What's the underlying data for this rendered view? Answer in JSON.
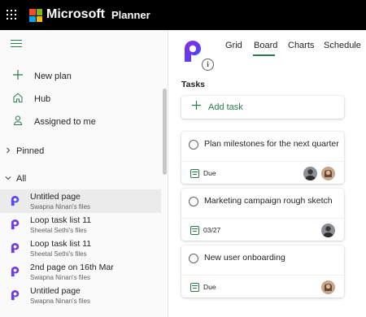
{
  "header": {
    "brand": "Microsoft",
    "app_name": "Planner",
    "brand_colors": [
      "#f25022",
      "#7fba00",
      "#00a4ef",
      "#ffb900"
    ]
  },
  "sidebar": {
    "nav": [
      {
        "icon": "plus-icon",
        "label": "New plan"
      },
      {
        "icon": "home-icon",
        "label": "Hub"
      },
      {
        "icon": "person-icon",
        "label": "Assigned to me"
      }
    ],
    "pinned_label": "Pinned",
    "all_label": "All",
    "plans": [
      {
        "title": "Untitled page",
        "owner": "Swapna Ninan's files"
      },
      {
        "title": "Loop task list 11",
        "owner": "Sheetal Sethi's files"
      },
      {
        "title": "Loop task list 11",
        "owner": "Sheetal Sethi's files"
      },
      {
        "title": "2nd page on 16th Mar",
        "owner": "Swapna Ninan's files"
      },
      {
        "title": "Untitled page",
        "owner": "Swapna Ninan's files"
      }
    ]
  },
  "main": {
    "tabs": [
      "Grid",
      "Board",
      "Charts",
      "Schedule"
    ],
    "active_tab": "Board",
    "bucket_title": "Tasks",
    "add_task_label": "Add task",
    "tasks": [
      {
        "title": "Plan milestones for the next quarter",
        "due": "Due"
      },
      {
        "title": "Marketing campaign rough sketch",
        "due": "03/27"
      },
      {
        "title": "New user onboarding",
        "due": "Due"
      }
    ]
  },
  "accent_color": "#2a7d4f"
}
